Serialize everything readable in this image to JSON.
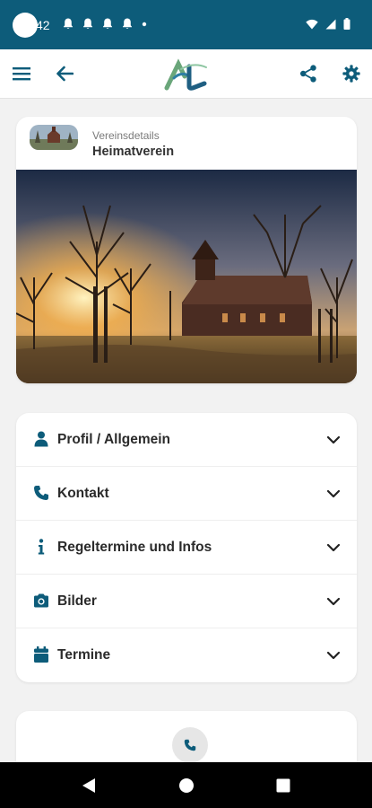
{
  "status_bar": {
    "time": "42",
    "notification_icons": [
      "bell-icon",
      "bell-icon",
      "bell-icon",
      "bell-icon",
      "dot-icon"
    ],
    "system_icons": [
      "wifi-icon",
      "signal-icon",
      "battery-icon"
    ],
    "background": "#0d5c7a"
  },
  "toolbar": {
    "menu_icon": "menu-icon",
    "back_icon": "arrow-left-icon",
    "logo": "AL",
    "share_icon": "share-icon",
    "settings_icon": "gear-icon",
    "icon_color": "#0d5c7a"
  },
  "club": {
    "subtitle": "Vereinsdetails",
    "title": "Heimatverein",
    "image": "church-at-sunrise-photo"
  },
  "menu": {
    "items": [
      {
        "label": "Profil / Allgemein",
        "icon": "person-icon"
      },
      {
        "label": "Kontakt",
        "icon": "phone-icon"
      },
      {
        "label": "Regeltermine und Infos",
        "icon": "info-icon"
      },
      {
        "label": "Bilder",
        "icon": "camera-icon"
      },
      {
        "label": "Termine",
        "icon": "calendar-icon"
      }
    ],
    "chevron_icon": "chevron-down-icon"
  },
  "contact": {
    "phone_icon": "phone-icon"
  },
  "nav_bar": {
    "buttons": [
      "back-triangle-icon",
      "home-circle-icon",
      "recents-square-icon"
    ]
  }
}
